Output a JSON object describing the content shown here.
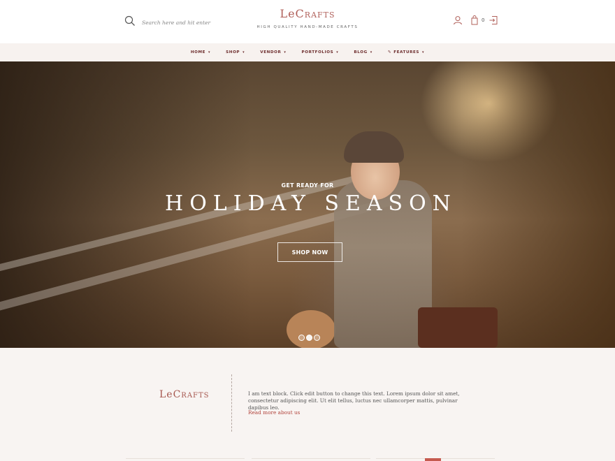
{
  "header": {
    "search_placeholder": "Search here and hit enter",
    "logo_le": "Le",
    "logo_crafts": "Crafts",
    "tagline": "HIGH QUALITY HAND-MADE CRAFTS",
    "cart_count": "0",
    "icons": [
      "search-icon",
      "user-icon",
      "shopping-bag-icon",
      "sign-in-icon"
    ]
  },
  "nav": {
    "items": [
      {
        "label": "HOME"
      },
      {
        "label": "SHOP"
      },
      {
        "label": "VENDOR"
      },
      {
        "label": "PORTFOLIOS"
      },
      {
        "label": "BLOG"
      },
      {
        "label": "FEATURES"
      }
    ],
    "chevron": "⌄"
  },
  "hero": {
    "eyebrow": "GET READY FOR",
    "headline": "HOLIDAY SEASON",
    "button": "SHOP NOW",
    "slides": 3,
    "active_slide": 2
  },
  "about": {
    "logo_le": "Le",
    "logo_crafts": "Crafts",
    "text": "I am text block. Click edit button to change this text. Lorem ipsum dolor sit amet, consectetur adipiscing elit. Ut elit tellus, luctus nec ullamcorper mattis, pulvinar dapibus leo.",
    "link": "Read more about us"
  },
  "colors": {
    "brand": "#b0605a",
    "nav_text": "#6b2b2b",
    "nav_bg": "#f7f2ef",
    "link": "#b2443d",
    "section_bg": "#f8f4f2"
  }
}
